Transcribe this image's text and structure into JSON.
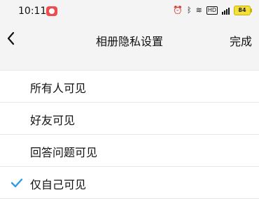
{
  "status_bar": {
    "time": "10:11",
    "battery": "84"
  },
  "nav": {
    "title": "相册隐私设置",
    "done_label": "完成"
  },
  "options": [
    {
      "label": "所有人可见",
      "selected": false
    },
    {
      "label": "好友可见",
      "selected": false
    },
    {
      "label": "回答问题可见",
      "selected": false
    },
    {
      "label": "仅自己可见",
      "selected": true
    }
  ],
  "colors": {
    "check": "#2f9be8"
  }
}
